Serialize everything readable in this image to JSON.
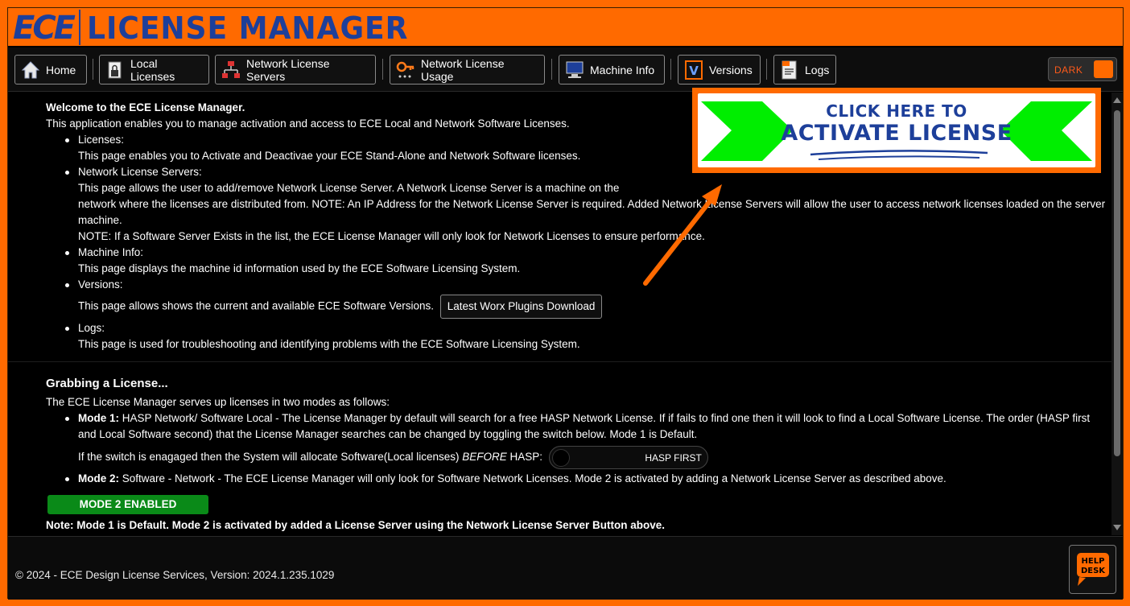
{
  "app": {
    "logo": "ECE",
    "title": "LICENSE MANAGER"
  },
  "nav": {
    "items": [
      {
        "label": "Home",
        "icon": "home-icon"
      },
      {
        "label": "Local Licenses",
        "icon": "local-license-icon"
      },
      {
        "label": "Network License Servers",
        "icon": "network-server-icon"
      },
      {
        "label": "Network License Usage",
        "icon": "key-usage-icon"
      },
      {
        "label": "Machine Info",
        "icon": "machine-info-icon"
      },
      {
        "label": "Versions",
        "icon": "versions-icon"
      },
      {
        "label": "Logs",
        "icon": "logs-icon"
      }
    ],
    "theme_toggle": {
      "label": "DARK",
      "state": "on"
    }
  },
  "banner": {
    "line1": "CLICK HERE TO",
    "line2": "ACTIVATE LICENSE",
    "arrow_color": "#00ee00",
    "frame_color": "#ff6a00"
  },
  "intro": {
    "heading": "Welcome to the ECE License Manager.",
    "subheading": "This application enables you to manage activation and access to ECE Local and Network Software Licenses.",
    "items": [
      {
        "title": "Licenses:",
        "lines": [
          "This page enables you to Activate and Deactivae your ECE Stand-Alone and Network Software licenses."
        ]
      },
      {
        "title": "Network License Servers:",
        "lines": [
          "This page allows the user to add/remove Network License Server. A Network License Server is a machine on the",
          "network where the licenses are distributed from. NOTE: An IP Address for the Network License Server is required. Added Network License Servers will allow the user to access network licenses loaded on the server machine.",
          "NOTE: If a Software Server Exists in the list, the ECE License Manager will only look for Network Licenses to ensure performance."
        ]
      },
      {
        "title": "Machine Info:",
        "lines": [
          "This page displays the machine id information used by the ECE Software Licensing System."
        ]
      },
      {
        "title": "Versions:",
        "lines": [
          "This page allows shows the current and available ECE Software Versions."
        ],
        "button": "Latest Worx Plugins Download"
      },
      {
        "title": "Logs:",
        "lines": [
          "This page is used for troubleshooting and identifying problems with the ECE Software Licensing System."
        ]
      }
    ]
  },
  "grabbing": {
    "heading": "Grabbing a License...",
    "intro": "The ECE License Manager serves up licenses in two modes as follows:",
    "mode1_label": "Mode 1:",
    "mode1_text": "HASP Network/ Software Local - The License Manager by default will search for a free HASP Network License. If if fails to find one then it will look to find a Local Software License. The order (HASP first and Local Software second) that the License Manager searches can be changed by toggling the switch below. Mode 1 is Default.",
    "switch_text_pre": "If the switch is enagaged then the System will allocate Software(Local licenses)",
    "switch_text_em": "BEFORE",
    "switch_text_post": "HASP:",
    "hasp_toggle_label": "HASP FIRST",
    "mode2_label": "Mode 2:",
    "mode2_text": "Software - Network - The ECE License Manager will only look for Software Network Licenses. Mode 2 is activated by adding a Network License Server as described above.",
    "mode_badge": "MODE 2 ENABLED",
    "note": "Note: Mode 1 is Default. Mode 2 is activated by added a License Server using the Network License Server Button above."
  },
  "footer": {
    "copyright": "© 2024 - ECE Design License Services, Version: 2024.1.235.1029",
    "help_line1": "HELP",
    "help_line2": "DESK"
  },
  "colors": {
    "brand_orange": "#ff6a00",
    "brand_blue": "#1d3f9a",
    "badge_green": "#0a8a18"
  }
}
